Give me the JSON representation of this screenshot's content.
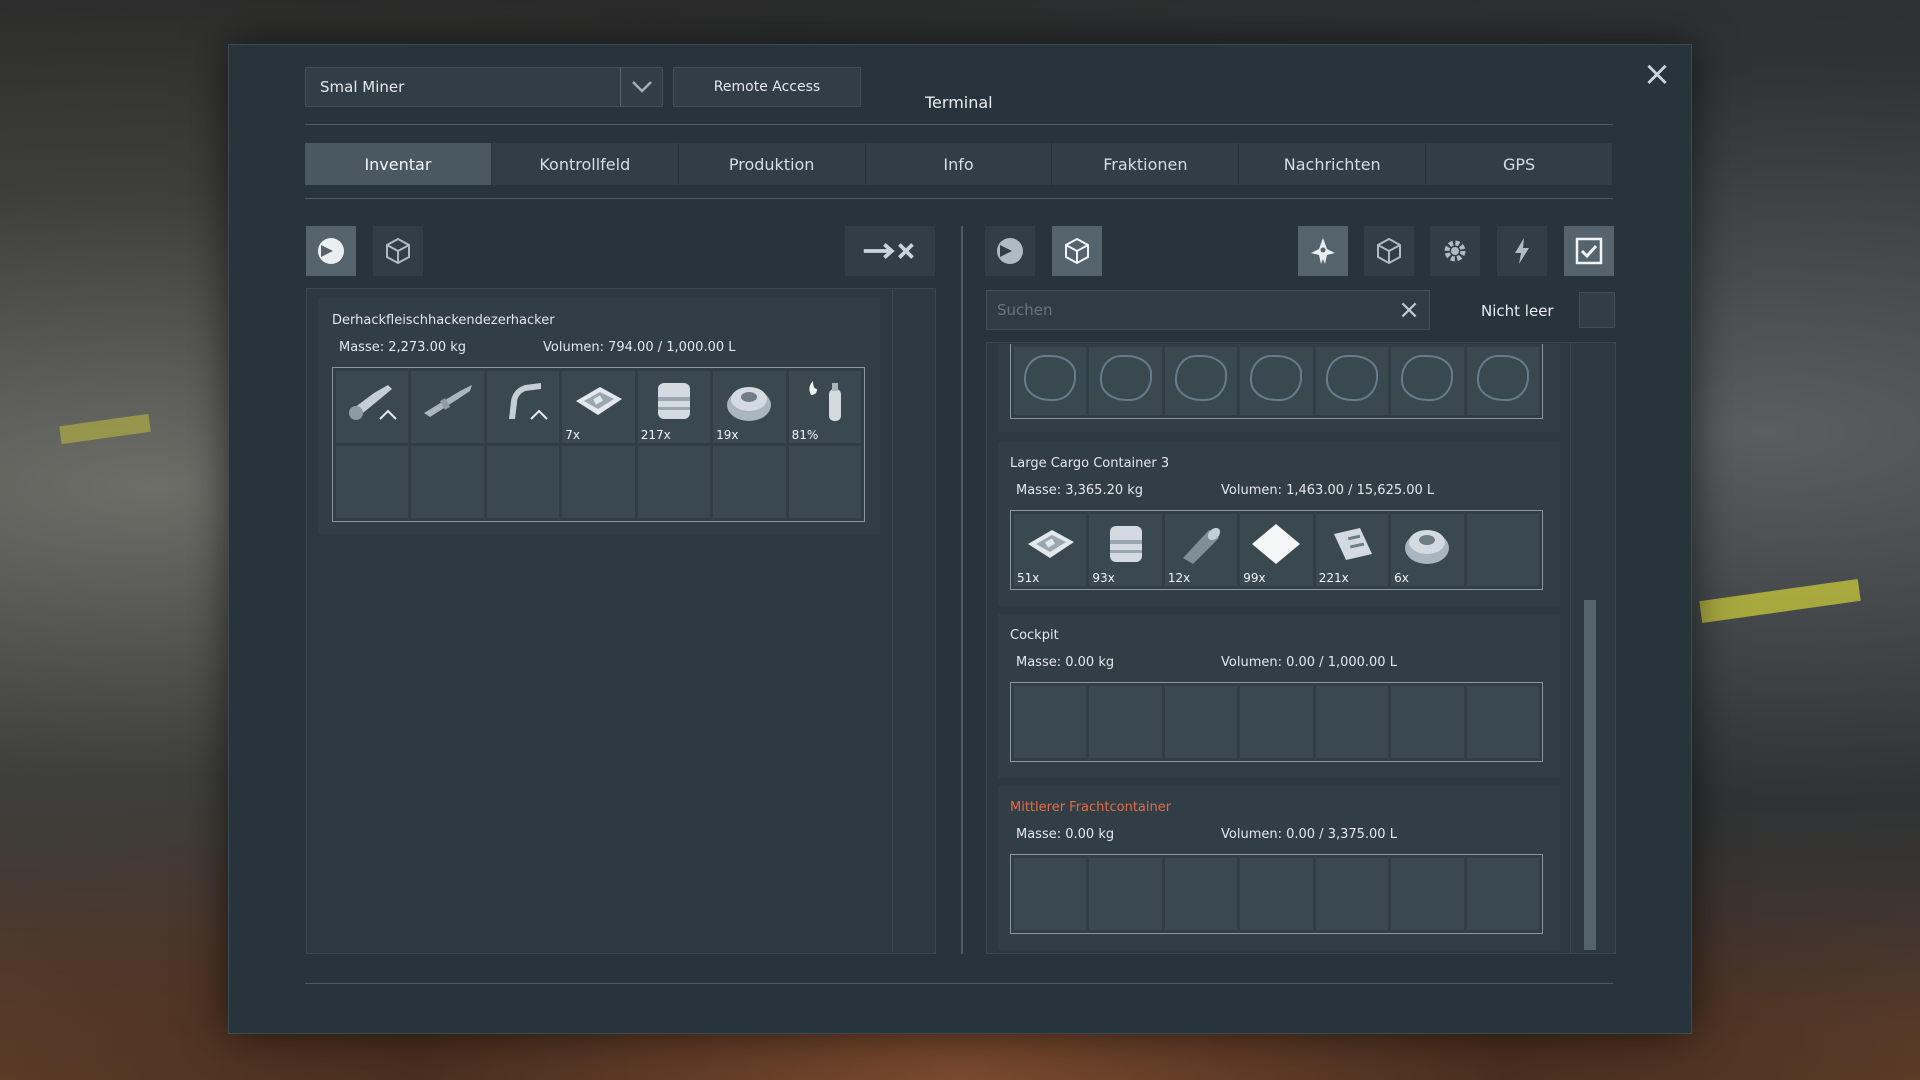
{
  "header": {
    "ship_name": "Smal Miner",
    "remote_access": "Remote Access",
    "title": "Terminal"
  },
  "tabs": [
    {
      "label": "Inventar",
      "active": true
    },
    {
      "label": "Kontrollfeld",
      "active": false
    },
    {
      "label": "Produktion",
      "active": false
    },
    {
      "label": "Info",
      "active": false
    },
    {
      "label": "Fraktionen",
      "active": false
    },
    {
      "label": "Nachrichten",
      "active": false
    },
    {
      "label": "GPS",
      "active": false
    }
  ],
  "left": {
    "container": {
      "name": "Derhackfleischhackendezerhacker",
      "mass": "Masse: 2,273.00 kg",
      "volume": "Volumen: 794.00 / 1,000.00 L",
      "items": [
        {
          "icon": "hand-drill-icon",
          "qty": ""
        },
        {
          "icon": "rifle-icon",
          "qty": ""
        },
        {
          "icon": "welder-icon",
          "qty": ""
        },
        {
          "icon": "metal-plate-icon",
          "qty": "7x"
        },
        {
          "icon": "steel-container-icon",
          "qty": "217x"
        },
        {
          "icon": "motor-icon",
          "qty": "19x"
        },
        {
          "icon": "hydrogen-bottle-icon",
          "qty": "81%"
        }
      ]
    }
  },
  "right": {
    "search_placeholder": "Suchen",
    "filter_label": "Nicht leer",
    "containers": [
      {
        "name": "Large Cargo Container 3",
        "mass": "Masse: 3,365.20 kg",
        "volume": "Volumen: 1,463.00 / 15,625.00 L",
        "highlight": false,
        "items": [
          {
            "icon": "metal-plate-icon",
            "qty": "51x"
          },
          {
            "icon": "steel-container-icon",
            "qty": "93x"
          },
          {
            "icon": "thruster-component-icon",
            "qty": "12x"
          },
          {
            "icon": "glass-icon",
            "qty": "99x"
          },
          {
            "icon": "computer-icon",
            "qty": "221x"
          },
          {
            "icon": "motor-icon",
            "qty": "6x"
          }
        ]
      },
      {
        "name": "Cockpit",
        "mass": "Masse: 0.00 kg",
        "volume": "Volumen: 0.00 / 1,000.00 L",
        "highlight": false,
        "items": []
      },
      {
        "name": "Mittlerer Frachtcontainer",
        "mass": "Masse: 0.00 kg",
        "volume": "Volumen: 0.00 / 3,375.00 L",
        "highlight": true,
        "items": []
      }
    ]
  },
  "colors": {
    "window_bg": "#28343c",
    "tab_active": "#4a5861",
    "highlight_red": "#e76a46"
  }
}
